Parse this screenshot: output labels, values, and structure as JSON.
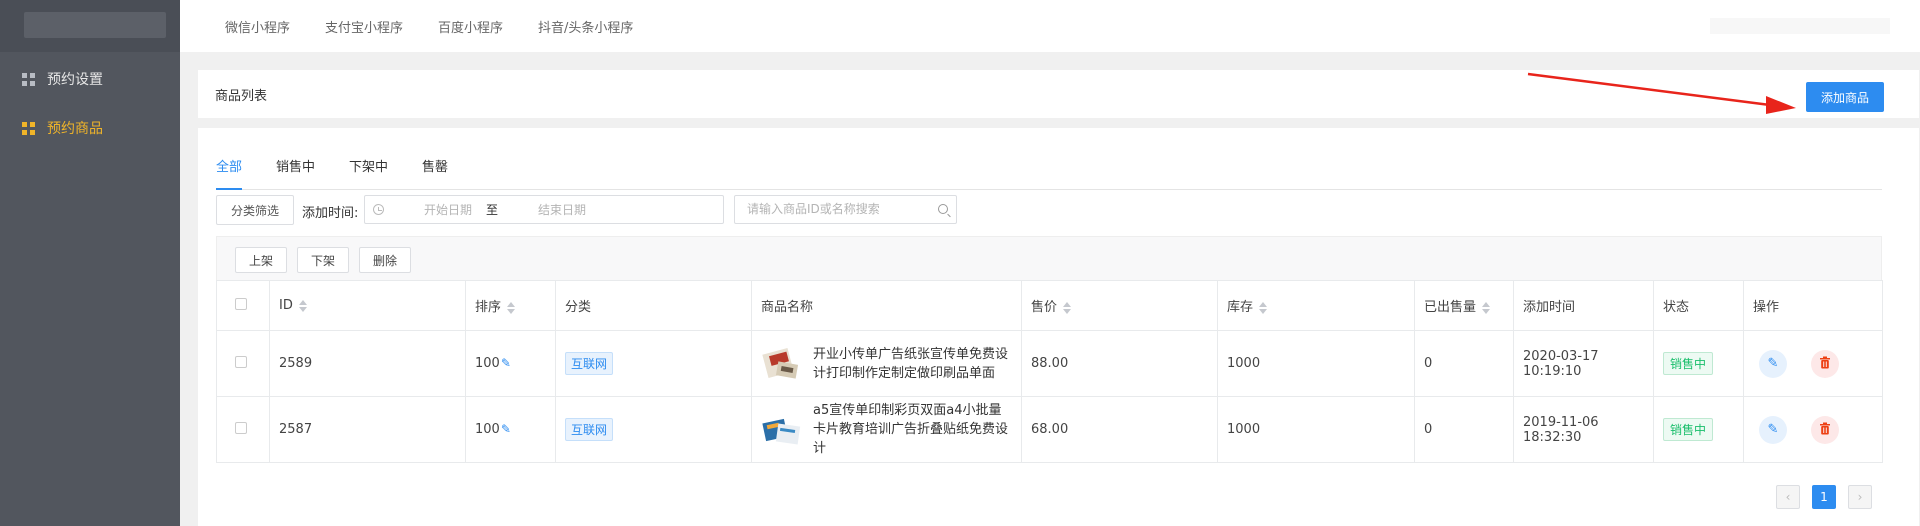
{
  "sidebar": {
    "items": [
      {
        "label": "预约设置",
        "icon": "grid-icon"
      },
      {
        "label": "预约商品",
        "icon": "grid-icon",
        "active": true
      }
    ]
  },
  "topbar": {
    "tabs": [
      "微信小程序",
      "支付宝小程序",
      "百度小程序",
      "抖音/头条小程序"
    ]
  },
  "header": {
    "title": "商品列表",
    "add_button": "添加商品"
  },
  "status_tabs": [
    "全部",
    "销售中",
    "下架中",
    "售罄"
  ],
  "filters": {
    "category_button": "分类筛选",
    "date_label": "添加时间:",
    "start_placeholder": "开始日期",
    "separator": "至",
    "end_placeholder": "结束日期",
    "search_placeholder": "请输入商品ID或名称搜索"
  },
  "bulk_actions": [
    "上架",
    "下架",
    "删除"
  ],
  "table": {
    "columns": [
      "ID",
      "排序",
      "分类",
      "商品名称",
      "售价",
      "库存",
      "已出售量",
      "添加时间",
      "状态",
      "操作"
    ],
    "rows": [
      {
        "id": "2589",
        "sort": "100",
        "category": "互联网",
        "name": "开业小传单广告纸张宣传单免费设计打印制作定制定做印刷品单面",
        "price": "88.00",
        "stock": "1000",
        "sold": "0",
        "added": "2020-03-17 10:19:10",
        "status": "销售中"
      },
      {
        "id": "2587",
        "sort": "100",
        "category": "互联网",
        "name": "a5宣传单印制彩页双面a4小批量卡片教育培训广告折叠贴纸免费设计",
        "price": "68.00",
        "stock": "1000",
        "sold": "0",
        "added": "2019-11-06 18:32:30",
        "status": "销售中"
      }
    ]
  },
  "pagination": {
    "prev": "‹",
    "current": "1",
    "next": "›"
  },
  "colors": {
    "primary": "#2d8cf0",
    "sidebar": "#52565e",
    "sidebar_active": "#f0b429",
    "success": "#19be6b",
    "danger": "#ed4014",
    "arrow": "#e8241b"
  }
}
